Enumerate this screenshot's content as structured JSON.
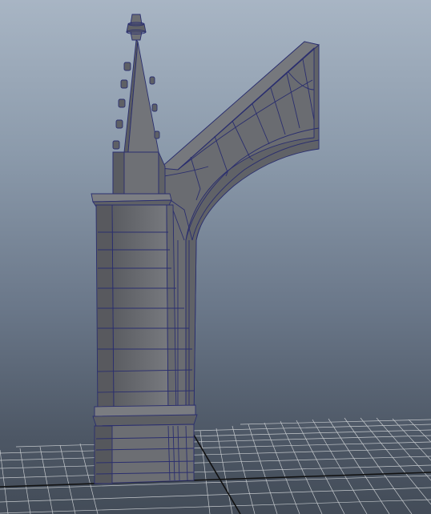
{
  "viewport": {
    "name": "perspective-viewport",
    "background_top": "#a8b5c4",
    "background_bottom": "#434c58"
  },
  "scene": {
    "object": "gothic-pillar-with-arch",
    "shaded_color": "#6b6d72",
    "wire_color": "#2a2e6e",
    "grid_color": "#c8ccd0",
    "grid_axis_color": "#111111"
  }
}
